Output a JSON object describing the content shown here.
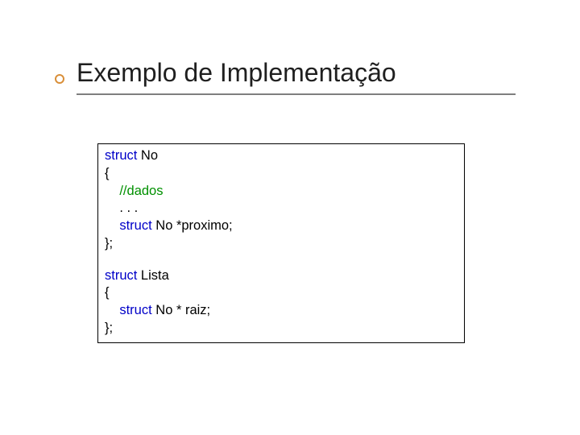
{
  "slide": {
    "title": "Exemplo de Implementação"
  },
  "code": {
    "kw_struct": "struct",
    "block1": {
      "decl_name": " No",
      "open": "{",
      "indent": "    ",
      "comment": "//dados",
      "ellipsis": ". . .",
      "ptr_line_rest": " No *proximo;",
      "close": "};"
    },
    "block2": {
      "decl_name": " Lista",
      "open": "{",
      "indent": "    ",
      "ptr_line_rest": " No * raiz;",
      "close": "};"
    }
  }
}
